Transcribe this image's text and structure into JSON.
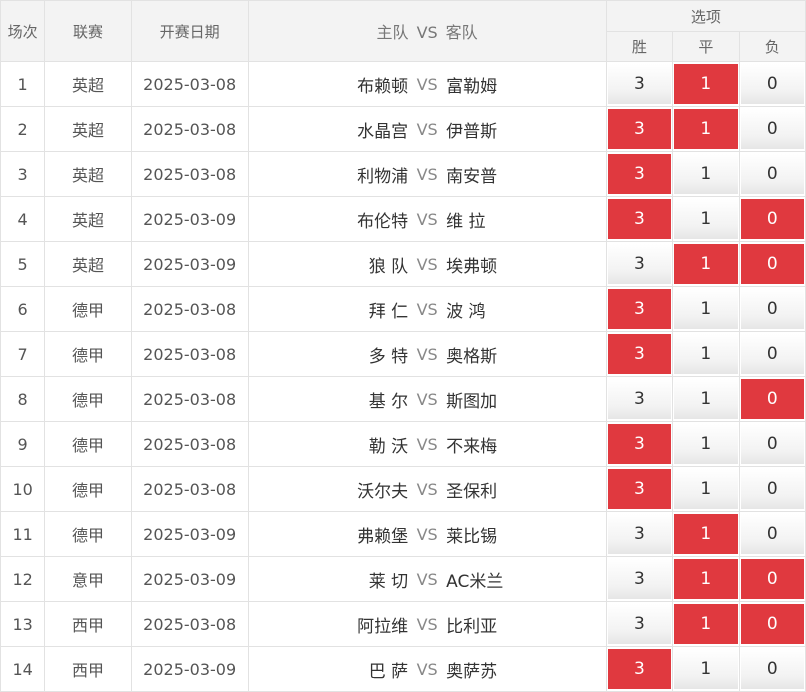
{
  "headers": {
    "num": "场次",
    "league": "联赛",
    "date": "开赛日期",
    "home": "主队",
    "vs": "VS",
    "away": "客队",
    "options": "选项",
    "win": "胜",
    "draw": "平",
    "lose": "负"
  },
  "colors": {
    "selected": "#e0393f",
    "border": "#e2e2e2",
    "header_bg": "#f3f3f3"
  },
  "rows": [
    {
      "num": "1",
      "league": "英超",
      "date": "2025-03-08",
      "home": "布赖顿",
      "vs": "VS",
      "away": "富勒姆",
      "win": "3",
      "draw": "1",
      "lose": "0",
      "win_sel": false,
      "draw_sel": true,
      "lose_sel": false
    },
    {
      "num": "2",
      "league": "英超",
      "date": "2025-03-08",
      "home": "水晶宫",
      "vs": "VS",
      "away": "伊普斯",
      "win": "3",
      "draw": "1",
      "lose": "0",
      "win_sel": true,
      "draw_sel": true,
      "lose_sel": false
    },
    {
      "num": "3",
      "league": "英超",
      "date": "2025-03-08",
      "home": "利物浦",
      "vs": "VS",
      "away": "南安普",
      "win": "3",
      "draw": "1",
      "lose": "0",
      "win_sel": true,
      "draw_sel": false,
      "lose_sel": false
    },
    {
      "num": "4",
      "league": "英超",
      "date": "2025-03-09",
      "home": "布伦特",
      "vs": "VS",
      "away": "维 拉",
      "win": "3",
      "draw": "1",
      "lose": "0",
      "win_sel": true,
      "draw_sel": false,
      "lose_sel": true
    },
    {
      "num": "5",
      "league": "英超",
      "date": "2025-03-09",
      "home": "狼 队",
      "vs": "VS",
      "away": "埃弗顿",
      "win": "3",
      "draw": "1",
      "lose": "0",
      "win_sel": false,
      "draw_sel": true,
      "lose_sel": true
    },
    {
      "num": "6",
      "league": "德甲",
      "date": "2025-03-08",
      "home": "拜 仁",
      "vs": "VS",
      "away": "波 鸿",
      "win": "3",
      "draw": "1",
      "lose": "0",
      "win_sel": true,
      "draw_sel": false,
      "lose_sel": false
    },
    {
      "num": "7",
      "league": "德甲",
      "date": "2025-03-08",
      "home": "多 特",
      "vs": "VS",
      "away": "奥格斯",
      "win": "3",
      "draw": "1",
      "lose": "0",
      "win_sel": true,
      "draw_sel": false,
      "lose_sel": false
    },
    {
      "num": "8",
      "league": "德甲",
      "date": "2025-03-08",
      "home": "基 尔",
      "vs": "VS",
      "away": "斯图加",
      "win": "3",
      "draw": "1",
      "lose": "0",
      "win_sel": false,
      "draw_sel": false,
      "lose_sel": true
    },
    {
      "num": "9",
      "league": "德甲",
      "date": "2025-03-08",
      "home": "勒 沃",
      "vs": "VS",
      "away": "不来梅",
      "win": "3",
      "draw": "1",
      "lose": "0",
      "win_sel": true,
      "draw_sel": false,
      "lose_sel": false
    },
    {
      "num": "10",
      "league": "德甲",
      "date": "2025-03-08",
      "home": "沃尔夫",
      "vs": "VS",
      "away": "圣保利",
      "win": "3",
      "draw": "1",
      "lose": "0",
      "win_sel": true,
      "draw_sel": false,
      "lose_sel": false
    },
    {
      "num": "11",
      "league": "德甲",
      "date": "2025-03-09",
      "home": "弗赖堡",
      "vs": "VS",
      "away": "莱比锡",
      "win": "3",
      "draw": "1",
      "lose": "0",
      "win_sel": false,
      "draw_sel": true,
      "lose_sel": false
    },
    {
      "num": "12",
      "league": "意甲",
      "date": "2025-03-09",
      "home": "莱 切",
      "vs": "VS",
      "away": "AC米兰",
      "win": "3",
      "draw": "1",
      "lose": "0",
      "win_sel": false,
      "draw_sel": true,
      "lose_sel": true
    },
    {
      "num": "13",
      "league": "西甲",
      "date": "2025-03-08",
      "home": "阿拉维",
      "vs": "VS",
      "away": "比利亚",
      "win": "3",
      "draw": "1",
      "lose": "0",
      "win_sel": false,
      "draw_sel": true,
      "lose_sel": true
    },
    {
      "num": "14",
      "league": "西甲",
      "date": "2025-03-09",
      "home": "巴 萨",
      "vs": "VS",
      "away": "奥萨苏",
      "win": "3",
      "draw": "1",
      "lose": "0",
      "win_sel": true,
      "draw_sel": false,
      "lose_sel": false
    }
  ]
}
